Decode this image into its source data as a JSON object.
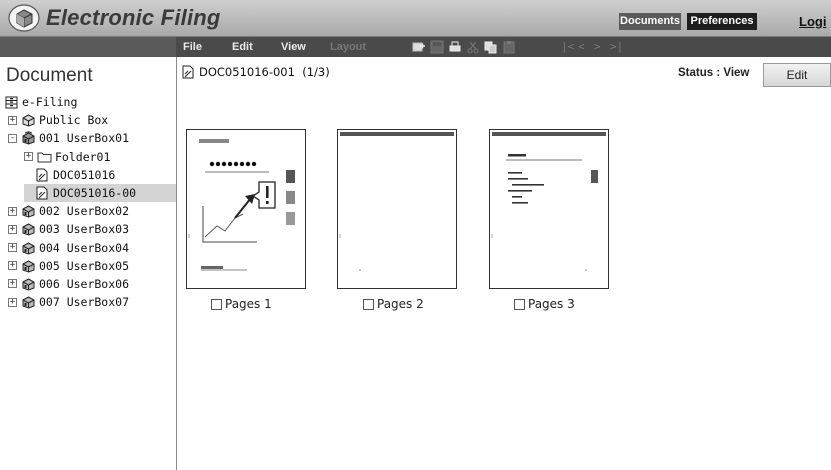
{
  "header": {
    "app_title": "Electronic Filing",
    "tabs": [
      {
        "label": "Documents",
        "active": true
      },
      {
        "label": "Preferences",
        "active": false
      }
    ],
    "login_label": "Logi"
  },
  "menubar": {
    "items": [
      {
        "label": "File",
        "enabled": true
      },
      {
        "label": "Edit",
        "enabled": true
      },
      {
        "label": "View",
        "enabled": true
      },
      {
        "label": "Layout",
        "enabled": false
      }
    ],
    "tools": [
      "insert-page-icon",
      "save-icon",
      "print-icon",
      "cut-icon",
      "copy-icon",
      "paste-icon"
    ],
    "nav": [
      "|<",
      "<",
      ">",
      ">|"
    ]
  },
  "sidebar": {
    "title": "Document",
    "tree": [
      {
        "label": "e-Filing",
        "icon": "cabinet-icon",
        "expander": "",
        "indent": 0
      },
      {
        "label": "Public Box",
        "icon": "box-icon",
        "expander": "+",
        "indent": 1
      },
      {
        "label": "001 UserBox01",
        "icon": "user-box-open-icon",
        "expander": "-",
        "indent": 1
      },
      {
        "label": "Folder01",
        "icon": "folder-icon",
        "expander": "+",
        "indent": 2
      },
      {
        "label": "DOC051016",
        "icon": "document-icon",
        "expander": "",
        "indent": 3
      },
      {
        "label": "DOC051016-00",
        "icon": "document-icon",
        "expander": "",
        "indent": 3,
        "selected": true
      },
      {
        "label": "002 UserBox02",
        "icon": "user-box-icon",
        "expander": "+",
        "indent": 1
      },
      {
        "label": "003 UserBox03",
        "icon": "user-box-icon",
        "expander": "+",
        "indent": 1
      },
      {
        "label": "004 UserBox04",
        "icon": "user-box-icon",
        "expander": "+",
        "indent": 1
      },
      {
        "label": "005 UserBox05",
        "icon": "user-box-icon",
        "expander": "+",
        "indent": 1
      },
      {
        "label": "006 UserBox06",
        "icon": "user-box-icon",
        "expander": "+",
        "indent": 1
      },
      {
        "label": "007 UserBox07",
        "icon": "user-box-icon",
        "expander": "+",
        "indent": 1
      }
    ]
  },
  "main": {
    "doc_title": "DOC051016-001",
    "doc_position": "(1/3)",
    "status_text": "Status : View",
    "edit_label": "Edit",
    "pages": [
      {
        "label": "Pages 1",
        "checked": false
      },
      {
        "label": "Pages 2",
        "checked": false
      },
      {
        "label": "Pages 3",
        "checked": false
      }
    ]
  },
  "colors": {
    "topbar": "#bdbdbd",
    "menubar": "#4a4a4a",
    "selected_row": "#d4d4d4"
  }
}
